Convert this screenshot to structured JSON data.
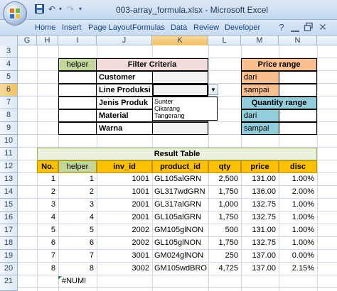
{
  "window": {
    "title": "003-array_formula.xlsx - Microsoft Excel"
  },
  "ribbon": {
    "tabs": [
      "Home",
      "Insert",
      "Page Layout",
      "Formulas",
      "Data",
      "Review",
      "Developer"
    ]
  },
  "grid": {
    "columns": [
      "G",
      "H",
      "I",
      "J",
      "K",
      "L",
      "M",
      "N"
    ],
    "rows": [
      "3",
      "4",
      "5",
      "6",
      "7",
      "8",
      "9",
      "10",
      "11",
      "12",
      "13",
      "14",
      "15",
      "16",
      "17",
      "18",
      "19",
      "20",
      "21"
    ]
  },
  "filter": {
    "helper": "helper",
    "title": "Filter Criteria",
    "labels": [
      "Customer",
      "Line Produksi",
      "Jenis Produk",
      "Material",
      "Warna"
    ],
    "dropdown_options": [
      "Sunter",
      "Cikarang",
      "Tangerang"
    ]
  },
  "price_range": {
    "title": "Price range",
    "from": "dari",
    "to": "sampai"
  },
  "qty_range": {
    "title": "Quantity range",
    "from": "dari",
    "to": "sampai"
  },
  "result": {
    "title": "Result Table",
    "headers": [
      "No.",
      "helper",
      "inv_id",
      "product_id",
      "qty",
      "price",
      "disc"
    ],
    "rows": [
      [
        "1",
        "1",
        "1001",
        "GL105alGRN",
        "2,500",
        "131.00",
        "1.00%"
      ],
      [
        "2",
        "2",
        "1001",
        "GL317wdGRN",
        "1,750",
        "136.00",
        "2.00%"
      ],
      [
        "3",
        "3",
        "2001",
        "GL317alGRN",
        "1,000",
        "132.75",
        "1.00%"
      ],
      [
        "4",
        "4",
        "2001",
        "GL105alGRN",
        "1,750",
        "132.75",
        "1.00%"
      ],
      [
        "5",
        "5",
        "2002",
        "GM105glNON",
        "500",
        "131.00",
        "1.00%"
      ],
      [
        "6",
        "6",
        "2002",
        "GL105glNON",
        "1,750",
        "132.75",
        "1.00%"
      ],
      [
        "7",
        "7",
        "3001",
        "GM024glNON",
        "250",
        "137.00",
        "0.00%"
      ],
      [
        "8",
        "8",
        "3002",
        "GM105wdBRO",
        "4,725",
        "137.00",
        "2.15%"
      ]
    ],
    "error": "#NUM!"
  },
  "colors": {
    "helper_green": "#c4d79b",
    "filter_pink": "#f2dcdb",
    "price_orange": "#fabf8f",
    "qty_blue": "#92cddc",
    "header_yellow": "#ffc000",
    "result_title_green": "#ebf1de"
  }
}
